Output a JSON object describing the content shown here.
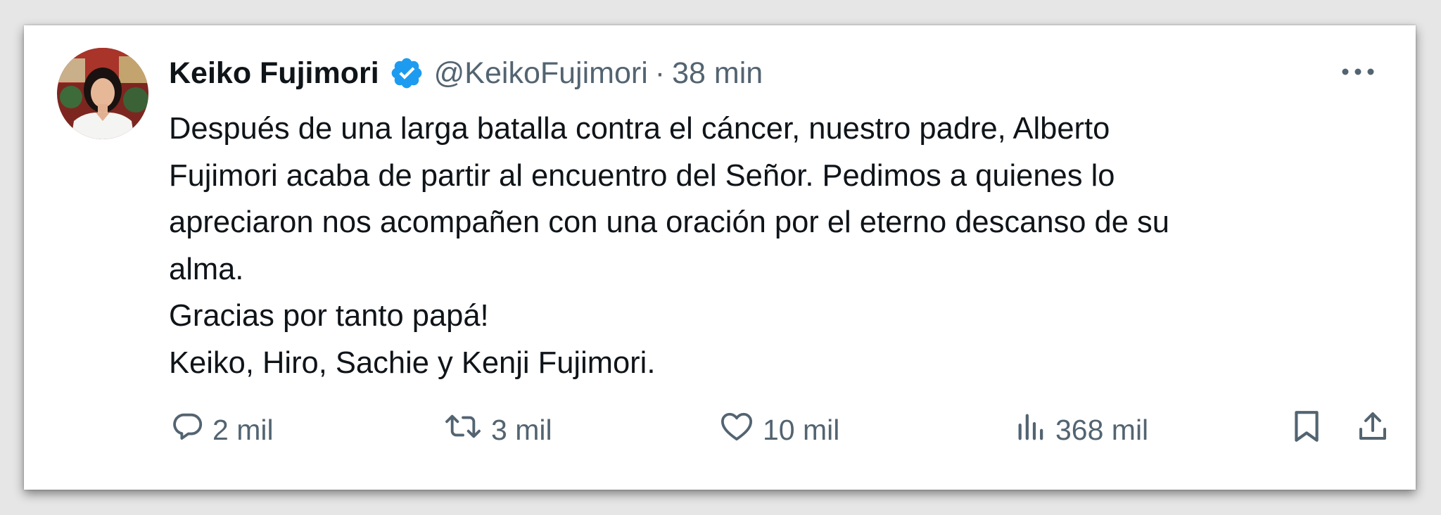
{
  "tweet": {
    "author_name": "Keiko Fujimori",
    "handle": "@KeikoFujimori",
    "separator": "·",
    "time": "38 min",
    "text_lines": [
      "Después de una larga batalla contra el cáncer, nuestro padre, Alberto",
      "Fujimori acaba de partir al encuentro del Señor. Pedimos a quienes lo",
      "apreciaron nos acompañen con una oración por el eterno descanso de su",
      "alma.",
      "Gracias por tanto papá!",
      "Keiko, Hiro, Sachie y Kenji Fujimori."
    ]
  },
  "actions": {
    "replies": "2 mil",
    "retweets": "3 mil",
    "likes": "10 mil",
    "views": "368 mil"
  },
  "icons": {
    "verified": "verified-badge-icon",
    "more": "more-dots-icon",
    "reply": "comment-bubble-icon",
    "retweet": "retweet-arrows-icon",
    "like": "heart-icon",
    "views": "bar-chart-icon",
    "bookmark": "bookmark-icon",
    "share": "share-upload-icon"
  },
  "colors": {
    "verified_blue": "#1d9bf0",
    "text_primary": "#0f1419",
    "text_secondary": "#536471"
  }
}
